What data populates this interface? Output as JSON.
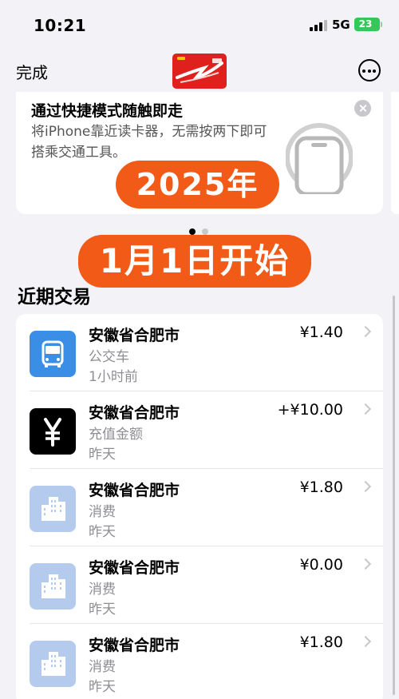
{
  "status_bar": {
    "time": "10:21",
    "network": "5G",
    "battery": "23"
  },
  "nav": {
    "done_label": "完成",
    "card_icon": "transit-card-thumbnail",
    "more_icon": "more-ellipsis-icon"
  },
  "tip": {
    "title": "通过快捷模式随触即走",
    "body": "将iPhone靠近读卡器，无需按两下即可搭乘交通工具。",
    "close_icon": "close-icon"
  },
  "overlay": {
    "line1": "2025年",
    "line2": "1月1日开始",
    "color": "#f25a17"
  },
  "section": {
    "title": "近期交易"
  },
  "transactions": [
    {
      "merchant": "安徽省合肥市",
      "type": "公交车",
      "time": "1小时前",
      "amount": "¥1.40",
      "icon": "bus-icon"
    },
    {
      "merchant": "安徽省合肥市",
      "type": "充值金额",
      "time": "昨天",
      "amount": "+¥10.00",
      "icon": "yen-icon"
    },
    {
      "merchant": "安徽省合肥市",
      "type": "消费",
      "time": "昨天",
      "amount": "¥1.80",
      "icon": "buildings-icon"
    },
    {
      "merchant": "安徽省合肥市",
      "type": "消费",
      "time": "昨天",
      "amount": "¥0.00",
      "icon": "buildings-icon"
    },
    {
      "merchant": "安徽省合肥市",
      "type": "消费",
      "time": "昨天",
      "amount": "¥1.80",
      "icon": "buildings-icon"
    }
  ],
  "colors": {
    "accent_blue": "#3a8ee6",
    "battery_green": "#34c759",
    "card_red": "#e0201d",
    "building_tile": "#b4cbee"
  }
}
